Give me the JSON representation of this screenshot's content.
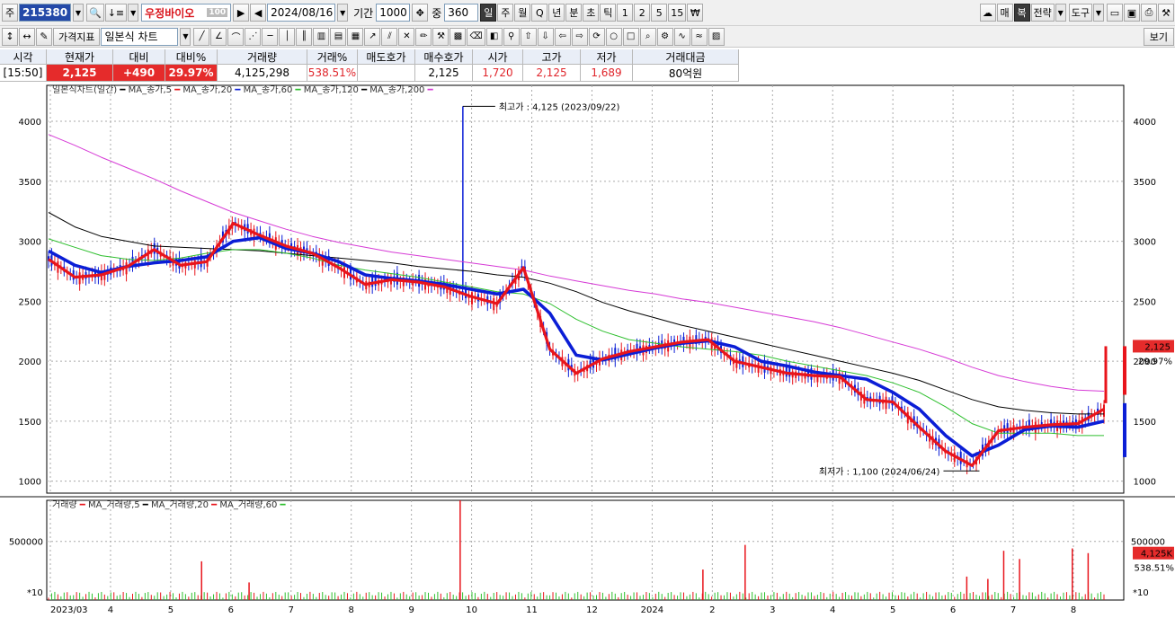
{
  "toolbar": {
    "stock_type": "주",
    "code": "215380",
    "stock_name": "우정바이오",
    "name_badge": "100",
    "date": "2024/08/16",
    "period_label": "기간",
    "period_value": "1000",
    "count_label": "중",
    "count_value": "360",
    "intervals": [
      "일",
      "주",
      "월",
      "Q",
      "년",
      "분",
      "초",
      "틱",
      "1",
      "2",
      "5",
      "15",
      "₩"
    ],
    "selected_interval": "일",
    "right_buttons": [
      "매",
      "복",
      "전략",
      "도구"
    ],
    "indicator_label": "가격지표",
    "chart_type_label": "일본식 차트",
    "view_label": "보기"
  },
  "info": {
    "headers": [
      "시각",
      "현재가",
      "대비",
      "대비%",
      "거래량",
      "거래%",
      "매도호가",
      "매수호가",
      "시가",
      "고가",
      "저가",
      "거래대금"
    ],
    "values": [
      "[15:50]",
      "2,125",
      "+490",
      "29.97%",
      "4,125,298",
      "538.51%",
      "",
      "2,125",
      "1,720",
      "2,125",
      "1,689",
      "80억원"
    ]
  },
  "price_legend": [
    {
      "text": "일본식차트(일간)",
      "color": "#000000"
    },
    {
      "text": "MA_종가,5",
      "color": "#e8141b"
    },
    {
      "text": "MA_종가,20",
      "color": "#0b1ed6"
    },
    {
      "text": "MA_종가,60",
      "color": "#2dbf2d"
    },
    {
      "text": "MA_종가,120",
      "color": "#000000"
    },
    {
      "text": "MA_종가,200",
      "color": "#d63ad6"
    }
  ],
  "volume_legend": [
    {
      "text": "거래량",
      "color": "#e8141b"
    },
    {
      "text": "MA_거래량,5",
      "color": "#000000"
    },
    {
      "text": "MA_거래량,20",
      "color": "#e8141b"
    },
    {
      "text": "MA_거래량,60",
      "color": "#2dbf2d"
    }
  ],
  "annotations": {
    "high": "최고가 : 4,125 (2023/09/22)",
    "low": "최저가 : 1,100 (2024/06/24)",
    "price_tag": "2,125",
    "price_pct": "29.97%",
    "vol_tag": "4,125K",
    "vol_pct": "538.51%",
    "scale_marker": "*10"
  },
  "colors": {
    "up": "#e8141b",
    "down": "#0b1ed6",
    "ma5": "#e8141b",
    "ma20": "#0b1ed6",
    "ma60": "#2dbf2d",
    "ma120": "#000000",
    "ma200": "#d63ad6"
  },
  "chart_data": {
    "type": "line",
    "x_ticks": [
      "2023/03",
      "4",
      "5",
      "6",
      "7",
      "8",
      "9",
      "10",
      "11",
      "12",
      "2024",
      "2",
      "3",
      "4",
      "5",
      "6",
      "7",
      "8"
    ],
    "price_axis": {
      "ylim": [
        900,
        4300
      ],
      "ticks": [
        1000,
        1500,
        2000,
        2500,
        3000,
        3500,
        4000
      ]
    },
    "volume_axis": {
      "ylim": [
        0,
        850000
      ],
      "ticks": [
        500000
      ]
    },
    "series": [
      {
        "name": "MA_종가,5",
        "key": "ma5",
        "values": [
          2850,
          2700,
          2720,
          2790,
          2930,
          2800,
          2830,
          3150,
          3050,
          2960,
          2900,
          2780,
          2640,
          2680,
          2660,
          2620,
          2540,
          2480,
          2780,
          2100,
          1900,
          2020,
          2080,
          2120,
          2160,
          2180,
          2000,
          1950,
          1900,
          1880,
          1870,
          1680,
          1660,
          1450,
          1250,
          1130,
          1420,
          1450,
          1470,
          1480,
          1600
        ]
      },
      {
        "name": "MA_종가,20",
        "key": "ma20",
        "values": [
          2920,
          2800,
          2740,
          2790,
          2820,
          2840,
          2870,
          3000,
          3030,
          2940,
          2900,
          2830,
          2720,
          2690,
          2670,
          2640,
          2600,
          2560,
          2600,
          2400,
          2050,
          2010,
          2060,
          2110,
          2150,
          2170,
          2120,
          2000,
          1960,
          1910,
          1880,
          1850,
          1740,
          1600,
          1380,
          1210,
          1300,
          1430,
          1460,
          1450,
          1500
        ]
      },
      {
        "name": "MA_종가,60",
        "key": "ma60",
        "values": [
          3020,
          2950,
          2880,
          2850,
          2840,
          2860,
          2900,
          2930,
          2930,
          2900,
          2860,
          2800,
          2760,
          2730,
          2700,
          2660,
          2620,
          2580,
          2560,
          2480,
          2350,
          2250,
          2180,
          2150,
          2120,
          2100,
          2080,
          2050,
          2000,
          1960,
          1920,
          1880,
          1820,
          1740,
          1620,
          1480,
          1400,
          1400,
          1400,
          1380,
          1380
        ]
      },
      {
        "name": "MA_종가,120",
        "key": "ma120",
        "values": [
          3240,
          3120,
          3040,
          3000,
          2960,
          2950,
          2940,
          2930,
          2920,
          2900,
          2880,
          2860,
          2840,
          2820,
          2790,
          2770,
          2750,
          2720,
          2700,
          2650,
          2580,
          2490,
          2420,
          2360,
          2300,
          2250,
          2200,
          2150,
          2100,
          2050,
          2000,
          1950,
          1900,
          1840,
          1760,
          1680,
          1620,
          1590,
          1570,
          1560,
          1560
        ]
      },
      {
        "name": "MA_종가,200",
        "key": "ma200",
        "values": [
          3890,
          3800,
          3700,
          3610,
          3520,
          3420,
          3330,
          3240,
          3170,
          3100,
          3040,
          2990,
          2950,
          2910,
          2880,
          2850,
          2820,
          2790,
          2760,
          2710,
          2670,
          2630,
          2590,
          2560,
          2520,
          2490,
          2450,
          2410,
          2370,
          2330,
          2280,
          2220,
          2160,
          2100,
          2030,
          1950,
          1880,
          1830,
          1790,
          1760,
          1750
        ]
      }
    ],
    "volume_spikes": [
      330000,
      150000,
      880000,
      260000,
      470000,
      200000,
      180000,
      420000,
      350000,
      440000,
      400000
    ],
    "last_price": 2125,
    "last_volume": 4125298
  }
}
